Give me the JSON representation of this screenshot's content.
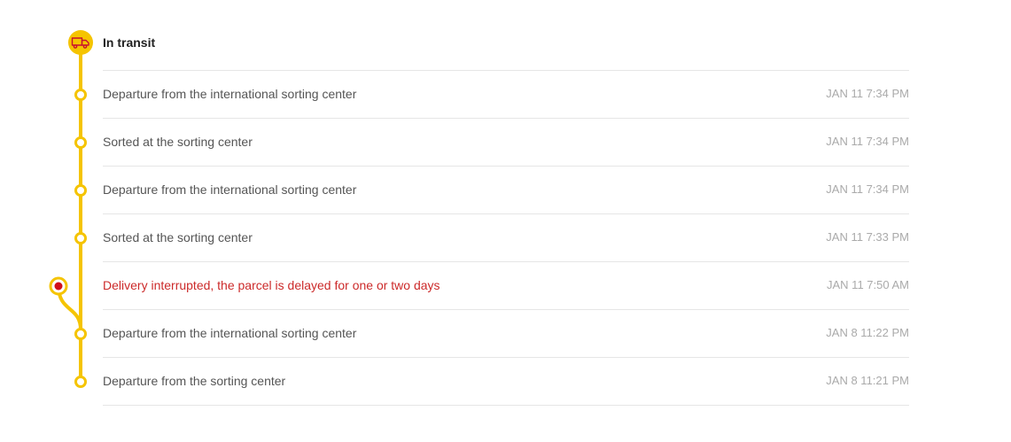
{
  "header": {
    "status_label": "In transit",
    "status_icon": "truck-icon"
  },
  "colors": {
    "accent": "#F5C400",
    "alert": "#CC2A2A",
    "alert_dot": "#D0101B",
    "icon_truck": "#C8102E"
  },
  "events": [
    {
      "text": "Departure from the international sorting center",
      "time": "JAN 11 7:34 PM",
      "alert": false
    },
    {
      "text": "Sorted at the sorting center",
      "time": "JAN 11 7:34 PM",
      "alert": false
    },
    {
      "text": "Departure from the international sorting center",
      "time": "JAN 11 7:34 PM",
      "alert": false
    },
    {
      "text": "Sorted at the sorting center",
      "time": "JAN 11 7:33 PM",
      "alert": false
    },
    {
      "text": "Delivery interrupted, the parcel is delayed for one or two days",
      "time": "JAN 11 7:50 AM",
      "alert": true
    },
    {
      "text": "Departure from the international sorting center",
      "time": "JAN 8 11:22 PM",
      "alert": false
    },
    {
      "text": "Departure from the sorting center",
      "time": "JAN 8 11:21 PM",
      "alert": false
    }
  ]
}
